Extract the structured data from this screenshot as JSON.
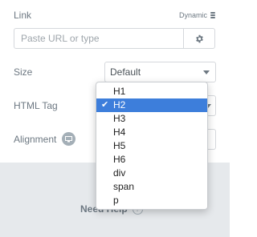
{
  "link": {
    "label": "Link",
    "dynamic_label": "Dynamic",
    "placeholder": "Paste URL or type",
    "settings_icon": "gear-icon"
  },
  "size": {
    "label": "Size",
    "value": "Default"
  },
  "html_tag": {
    "label": "HTML Tag",
    "selected": "H2",
    "options": [
      "H1",
      "H2",
      "H3",
      "H4",
      "H5",
      "H6",
      "div",
      "span",
      "p"
    ]
  },
  "alignment": {
    "label": "Alignment",
    "icon": "responsive-device-icon"
  },
  "help": {
    "label": "Need Help",
    "icon": "question-icon"
  },
  "colors": {
    "accent": "#3d7edb",
    "panel": "#e6e9ec",
    "label": "#6d7882"
  }
}
